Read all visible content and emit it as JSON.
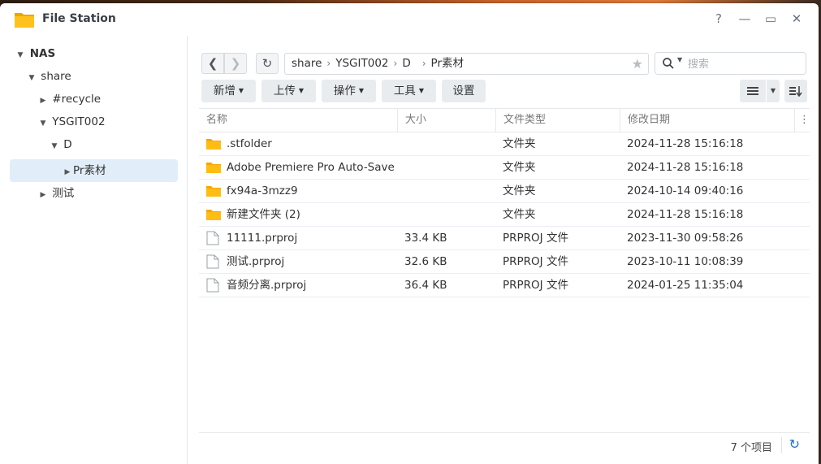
{
  "window": {
    "title": "File Station",
    "help_label": "?",
    "minimize_label": "—",
    "maximize_label": "▭",
    "close_label": "✕"
  },
  "sidebar": {
    "items": [
      {
        "label": "NAS",
        "level": 0,
        "expanded": true,
        "bold": true
      },
      {
        "label": "share",
        "level": 1,
        "expanded": true
      },
      {
        "label": "#recycle",
        "level": 2,
        "expanded": false
      },
      {
        "label": "YSGIT002",
        "level": 2,
        "expanded": true
      },
      {
        "label": "D",
        "level": 3,
        "expanded": true
      },
      {
        "label": "Pr素材",
        "level": 4,
        "expanded": false,
        "selected": true
      },
      {
        "label": "测试",
        "level": 2,
        "expanded": false
      }
    ]
  },
  "path": {
    "segments": [
      "share",
      "YSGIT002",
      "D",
      "Pr素材"
    ]
  },
  "search": {
    "placeholder": "搜索"
  },
  "toolbar": {
    "create": "新增",
    "upload": "上传",
    "action": "操作",
    "tools": "工具",
    "settings": "设置"
  },
  "table": {
    "headers": {
      "name": "名称",
      "size": "大小",
      "type": "文件类型",
      "modified": "修改日期"
    },
    "rows": [
      {
        "kind": "folder",
        "name": ".stfolder",
        "size": "",
        "type": "文件夹",
        "modified": "2024-11-28 15:16:18"
      },
      {
        "kind": "folder",
        "name": "Adobe Premiere Pro Auto-Save",
        "size": "",
        "type": "文件夹",
        "modified": "2024-11-28 15:16:18"
      },
      {
        "kind": "folder",
        "name": "fx94a-3mzz9",
        "size": "",
        "type": "文件夹",
        "modified": "2024-10-14 09:40:16"
      },
      {
        "kind": "folder",
        "name": "新建文件夹 (2)",
        "size": "",
        "type": "文件夹",
        "modified": "2024-11-28 15:16:18"
      },
      {
        "kind": "file",
        "name": "11111.prproj",
        "size": "33.4 KB",
        "type": "PRPROJ 文件",
        "modified": "2023-11-30 09:58:26"
      },
      {
        "kind": "file",
        "name": "测试.prproj",
        "size": "32.6 KB",
        "type": "PRPROJ 文件",
        "modified": "2023-10-11 10:08:39"
      },
      {
        "kind": "file",
        "name": "音频分离.prproj",
        "size": "36.4 KB",
        "type": "PRPROJ 文件",
        "modified": "2024-01-25 11:35:04"
      }
    ]
  },
  "footer": {
    "count": "7 个项目"
  },
  "colors": {
    "folder": "#f7b500",
    "accent": "#1e74c8",
    "selected_bg": "#e1edf9"
  },
  "icons": {
    "app": "folder-icon",
    "back": "chevron-left-icon",
    "forward": "chevron-right-icon",
    "refresh": "refresh-icon",
    "star": "star-icon",
    "search": "search-icon",
    "list_view": "list-view-icon",
    "sort": "sort-icon",
    "more": "more-vertical-icon"
  }
}
